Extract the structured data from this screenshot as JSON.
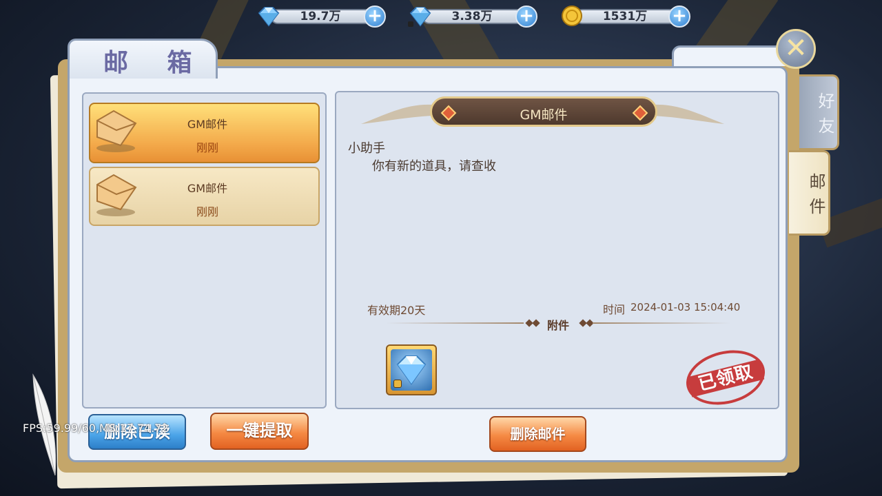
{
  "resources": [
    {
      "icon": "diamond-icon",
      "value": "19.7万",
      "locked": false
    },
    {
      "icon": "bound-diamond-icon",
      "value": "3.38万",
      "locked": true
    },
    {
      "icon": "gold-coin-icon",
      "value": "1531万",
      "locked": false
    }
  ],
  "panel": {
    "title": "邮 箱"
  },
  "side_tabs": [
    {
      "label": "好友",
      "active": false
    },
    {
      "label": "邮件",
      "active": true
    }
  ],
  "mail_list": [
    {
      "sender": "GM邮件",
      "time": "刚刚",
      "selected": true
    },
    {
      "sender": "GM邮件",
      "time": "刚刚",
      "selected": false
    }
  ],
  "detail": {
    "header": "GM邮件",
    "from": "小助手",
    "body": "你有新的道具，请查收",
    "validity": "有效期20天",
    "time_label": "时间",
    "time_value": "2024-01-03 15:04:40",
    "attachment_label": "附件",
    "attachment_items": [
      {
        "icon": "diamond-icon",
        "locked": true
      }
    ],
    "stamp": "已领取"
  },
  "buttons": {
    "delete_read": "删除已读",
    "claim_all": "一键提取",
    "delete_mail": "删除邮件"
  },
  "fps_overlay": "FPS:59.99/60,MS:17.74.72",
  "colors": {
    "accent_orange": "#f58a44",
    "accent_blue": "#4aa3e8",
    "stamp_red": "#c52a2a",
    "title_purple": "#6b6aa3"
  }
}
